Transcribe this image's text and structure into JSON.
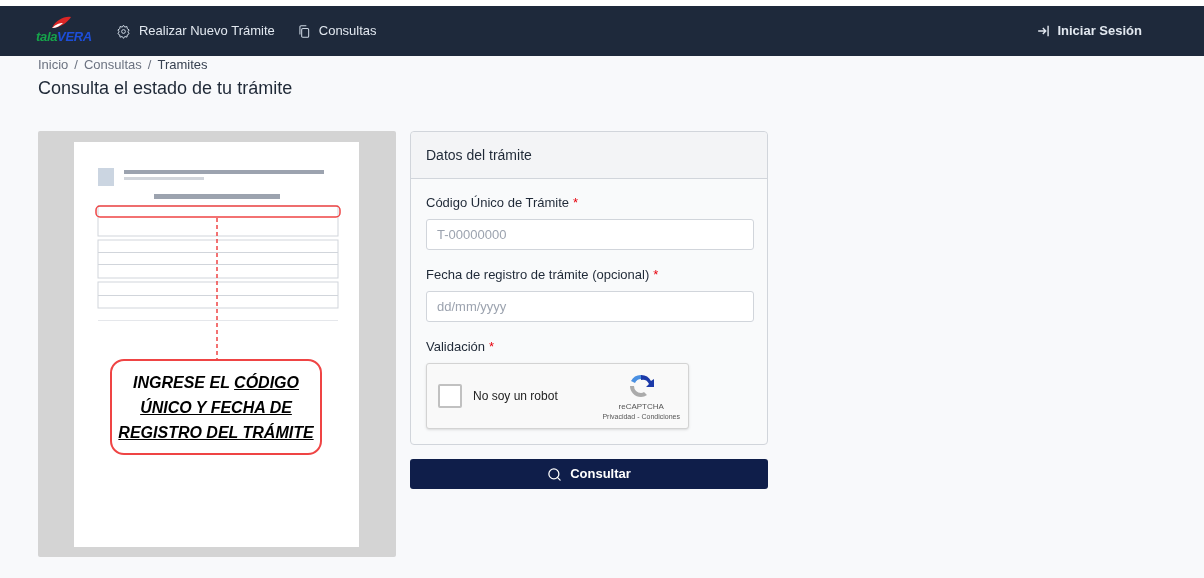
{
  "nav": {
    "logo": [
      {
        "text": "tala",
        "color": "#16a34a"
      },
      {
        "text": "VERA",
        "color": "#1d4ed8"
      }
    ],
    "items": [
      {
        "label": "Realizar Nuevo Trámite"
      },
      {
        "label": "Consultas"
      }
    ],
    "login": "Iniciar Sesión"
  },
  "breadcrumb": [
    "Inicio",
    "/",
    "Consultas",
    "/",
    "Tramites"
  ],
  "title": "Consulta el estado de tu trámite",
  "guide": {
    "callout": "INGRESE EL **CÓDIGO ÚNICO Y FECHA DE REGISTRO DEL TRÁMITE**"
  },
  "form": {
    "title": "Datos del trámite",
    "fields": [
      {
        "label": "Código Único de Trámite",
        "mark": "*",
        "placeholder": "T-00000000"
      },
      {
        "label": "Fecha de registro de trámite (opcional)",
        "mark": "*",
        "placeholder": "dd/mm/yyyy"
      }
    ],
    "validation": {
      "label": "Validación",
      "mark": "*",
      "checked": false,
      "text": "No soy un robot",
      "brand": "reCAPTCHA",
      "links": [
        "Privacidad",
        "Condiciones"
      ],
      "separator": "-"
    },
    "submit": "Consultar"
  }
}
